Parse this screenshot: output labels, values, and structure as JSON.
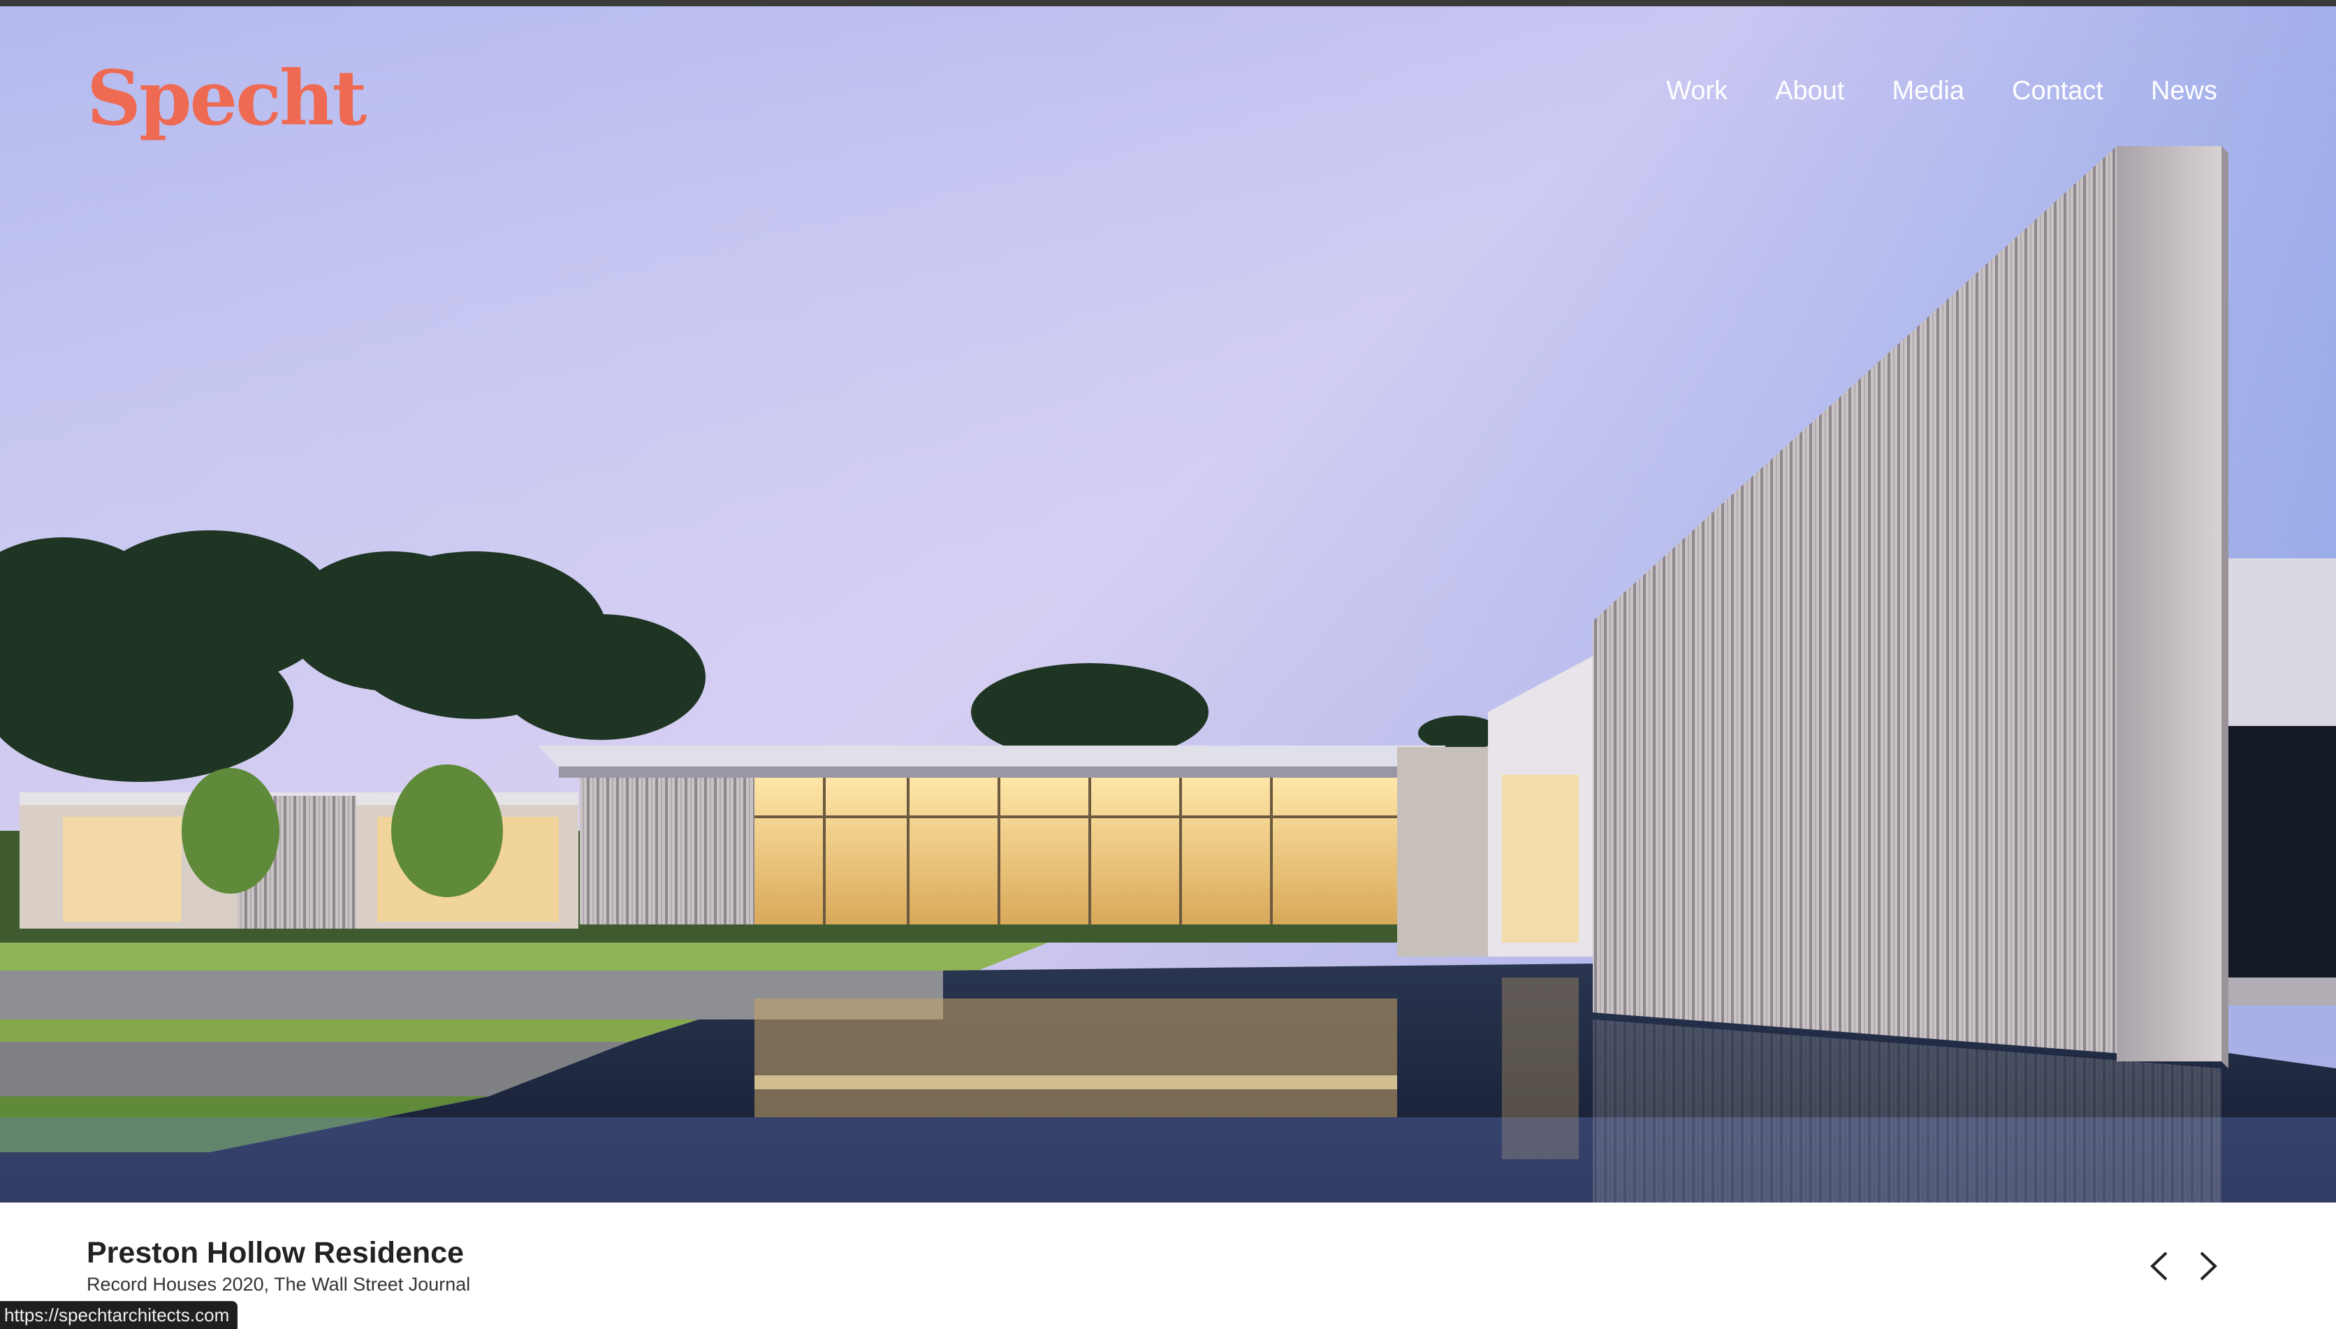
{
  "site": {
    "logo": "Specht",
    "brand_color": "#ee6a52"
  },
  "nav": {
    "items": [
      {
        "label": "Work"
      },
      {
        "label": "About"
      },
      {
        "label": "Media"
      },
      {
        "label": "Contact"
      },
      {
        "label": "News"
      }
    ]
  },
  "hero": {
    "image": "modern-house-pool-dusk"
  },
  "caption": {
    "title": "Preston Hollow Residence",
    "subtitle": "Record Houses 2020, The Wall Street Journal"
  },
  "slider": {
    "prev_icon": "chevron-left-icon",
    "next_icon": "chevron-right-icon"
  },
  "status_bar": {
    "url": "https://spechtarchitects.com"
  }
}
